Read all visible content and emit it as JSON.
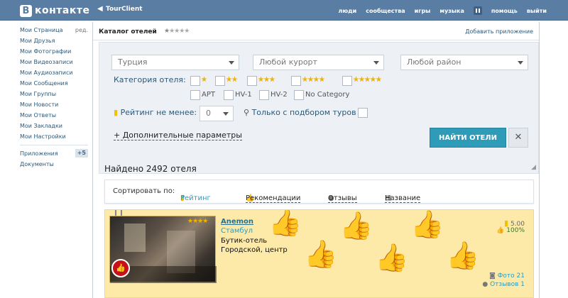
{
  "topbar": {
    "logo_letter": "В",
    "logo_text": "контакте",
    "back_arrow": "◀",
    "app_title": "TourClient",
    "nav": [
      "люди",
      "сообщества",
      "игры",
      "музыка",
      "помощь",
      "выйти"
    ]
  },
  "sidebar": {
    "items": [
      {
        "label": "Мои Страница",
        "extra": "ред."
      },
      {
        "label": "Мои Друзья"
      },
      {
        "label": "Мои Фотографии"
      },
      {
        "label": "Мои Видеозаписи"
      },
      {
        "label": "Мои Аудиозаписи"
      },
      {
        "label": "Мои Сообщения"
      },
      {
        "label": "Мои Группы"
      },
      {
        "label": "Мои Новости"
      },
      {
        "label": "Мои Ответы"
      },
      {
        "label": "Мои Закладки"
      },
      {
        "label": "Мои Настройки"
      }
    ],
    "apps": {
      "label": "Приложения",
      "badge": "+5"
    },
    "docs": {
      "label": "Документы"
    }
  },
  "app_header": {
    "title": "Каталог отелей",
    "rating_stars": 1,
    "rating_max": 5,
    "add_app": "Добавить приложение"
  },
  "filter": {
    "country": "Турция",
    "resort": "Любой курорт",
    "district": "Любой район",
    "category_label": "Категория отеля:",
    "star_levels": [
      1,
      2,
      3,
      4,
      5
    ],
    "categories_text": [
      "APT",
      "HV-1",
      "HV-2",
      "No Category"
    ],
    "rating_label": "Рейтинг не менее:",
    "rating_value": "0",
    "tours_label": "Только с подбором туров",
    "more_params": "+ Дополнительные параметры",
    "find_button": "НАЙТИ ОТЕЛИ",
    "close_button": "✕"
  },
  "results": {
    "found": "Найдено 2492 отеля"
  },
  "sort": {
    "label": "Сортировать по:",
    "rating": "Рейтинг",
    "recommendations": "Рекомендации",
    "reviews": "Отзывы",
    "name": "Название"
  },
  "hotel": {
    "name": "Anemon",
    "city": "Стамбул",
    "type": "Бутик-отель",
    "area": "Городской, центр",
    "stars": 4,
    "score": "5.00",
    "percent": "100%",
    "photos": "Фото 21",
    "reviews": "Отзывов 1"
  },
  "colors": {
    "topbar": "#597da3",
    "accent": "#2e9bb9",
    "card_bg": "#fdeaa9"
  }
}
